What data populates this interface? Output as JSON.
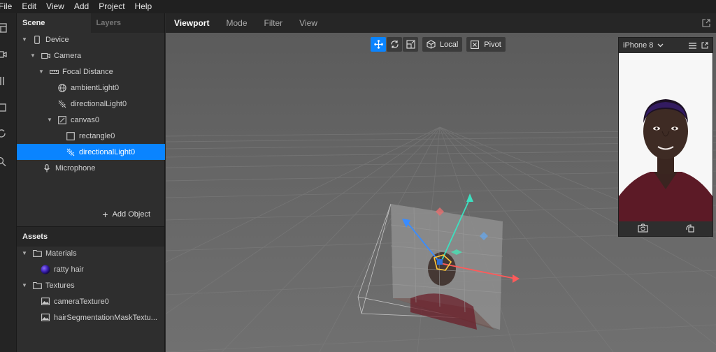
{
  "menu": [
    "File",
    "Edit",
    "View",
    "Add",
    "Project",
    "Help"
  ],
  "scene_panel": {
    "tabs": [
      "Scene",
      "Layers"
    ],
    "tree": [
      {
        "label": "Device",
        "icon": "device-icon"
      },
      {
        "label": "Camera",
        "icon": "camera-icon"
      },
      {
        "label": "Focal Distance",
        "icon": "focal-distance-icon"
      },
      {
        "label": "ambientLight0",
        "icon": "ambient-light-icon"
      },
      {
        "label": "directionalLight0",
        "icon": "directional-light-icon"
      },
      {
        "label": "canvas0",
        "icon": "canvas-icon"
      },
      {
        "label": "rectangle0",
        "icon": "rectangle-icon"
      },
      {
        "label": "directionalLight0",
        "icon": "directional-light-icon",
        "selected": true
      },
      {
        "label": "Microphone",
        "icon": "microphone-icon"
      }
    ],
    "add_object": "Add Object"
  },
  "assets_panel": {
    "title": "Assets",
    "tree": [
      {
        "label": "Materials",
        "icon": "folder-icon"
      },
      {
        "label": "ratty hair",
        "icon": "material-sphere-icon"
      },
      {
        "label": "Textures",
        "icon": "folder-icon"
      },
      {
        "label": "cameraTexture0",
        "icon": "texture-icon"
      },
      {
        "label": "hairSegmentationMaskTextu...",
        "icon": "texture-icon"
      }
    ]
  },
  "viewport": {
    "tabs": [
      "Viewport",
      "Mode",
      "Filter",
      "View"
    ],
    "toolbar": {
      "local_label": "Local",
      "pivot_label": "Pivot"
    }
  },
  "preview": {
    "device": "iPhone 8"
  },
  "colors": {
    "accent": "#0a84ff",
    "panel": "#2e2e2e",
    "viewport_bg": "#6a6a6a",
    "gizmo_x": "#ff5a5a",
    "gizmo_y": "#3de0c0",
    "gizmo_z": "#3a8cff"
  }
}
